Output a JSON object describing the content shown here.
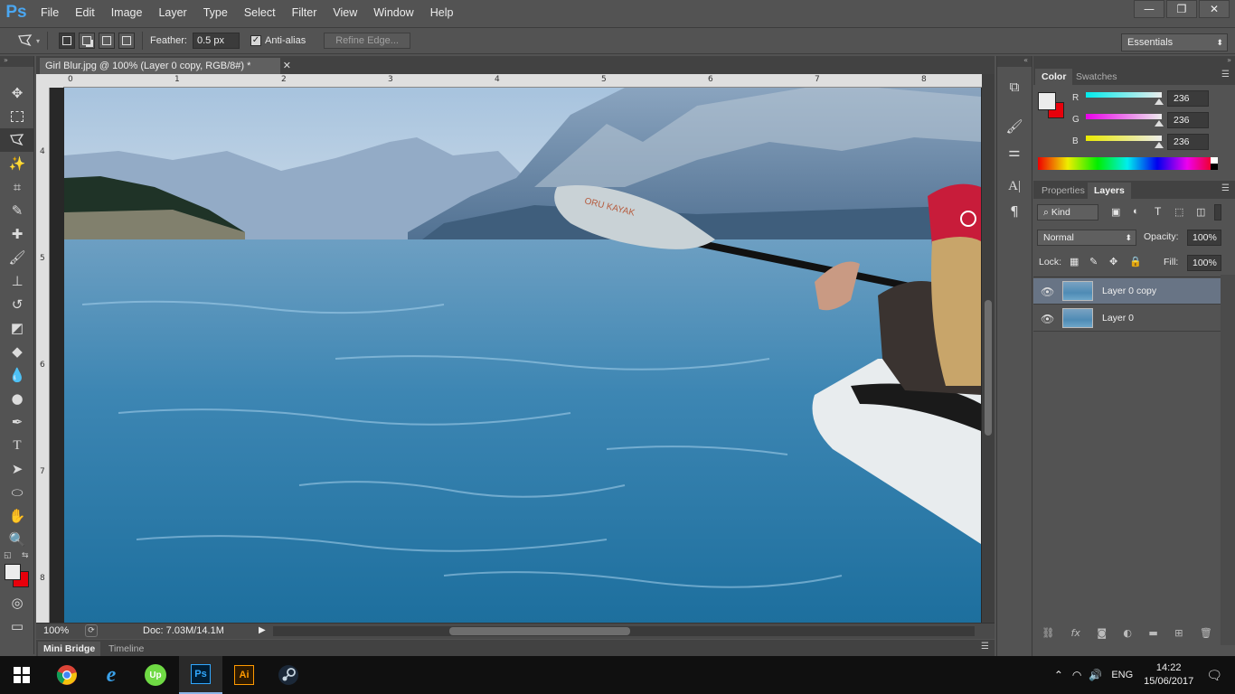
{
  "app": {
    "logo": "Ps"
  },
  "menu": [
    "File",
    "Edit",
    "Image",
    "Layer",
    "Type",
    "Select",
    "Filter",
    "View",
    "Window",
    "Help"
  ],
  "window_controls": {
    "minimize": "—",
    "restore": "❐",
    "close": "✕"
  },
  "options": {
    "feather_label": "Feather:",
    "feather_value": "0.5 px",
    "antialias_label": "Anti-alias",
    "antialias_checked": true,
    "refine_edge": "Refine Edge...",
    "workspace": "Essentials"
  },
  "document": {
    "tab_title": "Girl Blur.jpg @ 100% (Layer 0 copy, RGB/8#) *",
    "zoom": "100%",
    "doc_size": "Doc: 7.03M/14.1M",
    "ruler_h": [
      "0",
      "1",
      "2",
      "3",
      "4",
      "5",
      "6",
      "7",
      "8"
    ],
    "ruler_v": [
      "4",
      "5",
      "6",
      "7",
      "8"
    ],
    "paddle_text": "ORU KAYAK"
  },
  "bottom_tabs": [
    "Mini Bridge",
    "Timeline"
  ],
  "color_panel": {
    "tabs": [
      "Color",
      "Swatches"
    ],
    "channels": [
      {
        "label": "R",
        "value": "236"
      },
      {
        "label": "G",
        "value": "236"
      },
      {
        "label": "B",
        "value": "236"
      }
    ],
    "foreground": "#ececec",
    "background": "#e8000b"
  },
  "layers_panel": {
    "tabs": [
      "Properties",
      "Layers"
    ],
    "filter": "Kind",
    "blend_mode": "Normal",
    "opacity_label": "Opacity:",
    "opacity": "100%",
    "lock_label": "Lock:",
    "fill_label": "Fill:",
    "fill": "100%",
    "layers": [
      {
        "name": "Layer 0 copy",
        "selected": true
      },
      {
        "name": "Layer 0",
        "selected": false
      }
    ]
  },
  "taskbar": {
    "apps": [
      "chrome",
      "internet-explorer",
      "upwork",
      "photoshop",
      "illustrator",
      "steam"
    ],
    "photoshop_label": "Ps",
    "illustrator_label": "Ai",
    "upwork_label": "Up",
    "language": "ENG",
    "time": "14:22",
    "date": "15/06/2017"
  }
}
